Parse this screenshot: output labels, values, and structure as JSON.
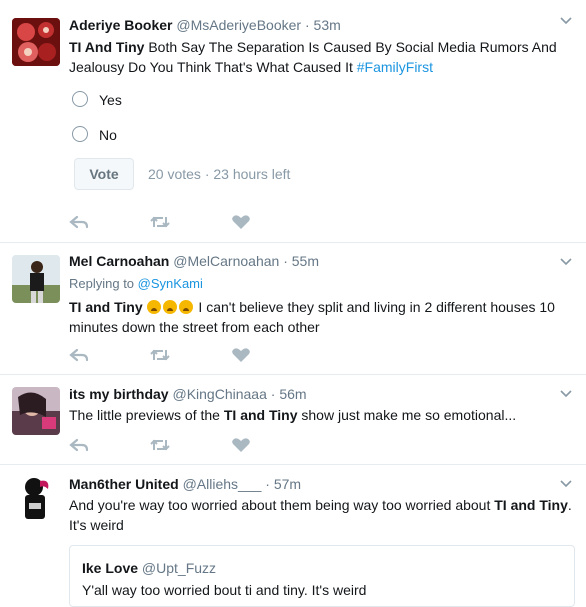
{
  "tweets": [
    {
      "name": "Aderiye Booker",
      "handle": "@MsAderiyeBooker",
      "time": "53m",
      "text_bold": "TI And Tiny",
      "text_rest": " Both Say The Separation Is Caused By Social Media Rumors And Jealousy Do You Think That's What Caused It ",
      "hashtag": "#FamilyFirst",
      "poll": {
        "options": [
          "Yes",
          "No"
        ],
        "vote_label": "Vote",
        "votes": "20 votes",
        "time_left": "23 hours left"
      }
    },
    {
      "name": "Mel Carnoahan",
      "handle": "@MelCarnoahan",
      "time": "55m",
      "replying_prefix": "Replying to",
      "replying_to": "@SynKami",
      "text_bold": "TI and Tiny",
      "text_rest": " I can't believe they split and living in 2 different houses 10 minutes down the street from each other"
    },
    {
      "name": "its my birthday",
      "handle": "@KingChinaaa",
      "time": "56m",
      "text_pre": "The little previews of the ",
      "text_bold": "TI and Tiny",
      "text_rest": " show just make me so emotional..."
    },
    {
      "name": "Man6ther United",
      "handle": "@Alliehs___",
      "time": "57m",
      "text_pre": "And you're way too worried about them being way too worried about ",
      "text_bold": "TI and Tiny",
      "text_rest": ". It's weird",
      "quote": {
        "name": "Ike Love",
        "handle": "@Upt_Fuzz",
        "text": "Y'all way too worried bout ti and tiny. It's weird"
      }
    }
  ],
  "separator": "·",
  "colors": {
    "link": "#1b95e0",
    "muted": "#657786",
    "border": "#e6ecf0"
  }
}
